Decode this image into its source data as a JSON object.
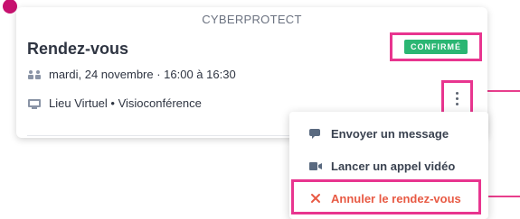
{
  "card": {
    "org": "CYBERPROTECT",
    "title": "Rendez-vous",
    "status": "CONFIRMÉ",
    "date_line": "mardi, 24 novembre · 16:00 à 16:30",
    "location_line": "Lieu Virtuel • Visioconférence"
  },
  "menu": {
    "items": [
      {
        "label": "Envoyer un message",
        "icon": "chat-icon"
      },
      {
        "label": "Lancer un appel vidéo",
        "icon": "video-camera-icon"
      },
      {
        "label": "Annuler le rendez-vous",
        "icon": "close-icon"
      }
    ]
  },
  "colors": {
    "accent_highlight": "#e8358f",
    "status_green": "#2bb673",
    "danger": "#e85a44"
  }
}
